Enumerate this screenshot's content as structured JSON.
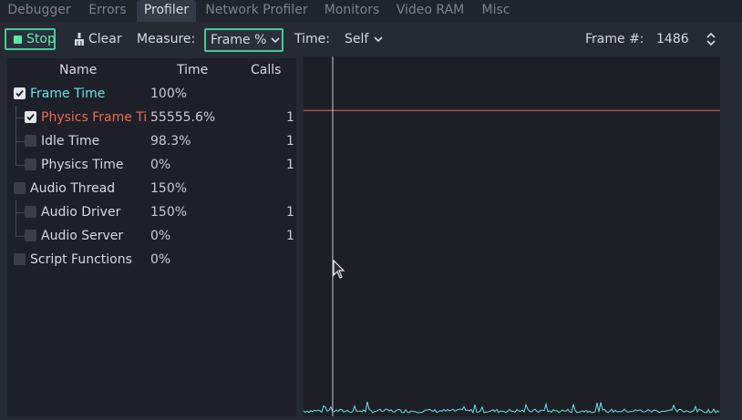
{
  "tabs": [
    {
      "label": "Debugger",
      "active": false
    },
    {
      "label": "Errors",
      "active": false
    },
    {
      "label": "Profiler",
      "active": true
    },
    {
      "label": "Network Profiler",
      "active": false
    },
    {
      "label": "Monitors",
      "active": false
    },
    {
      "label": "Video RAM",
      "active": false
    },
    {
      "label": "Misc",
      "active": false
    }
  ],
  "toolbar": {
    "stop_label": "Stop",
    "clear_label": "Clear",
    "measure_label": "Measure:",
    "measure_value": "Frame %",
    "time_label": "Time:",
    "time_value": "Self",
    "frame_label": "Frame #:",
    "frame_value": "1486"
  },
  "tree": {
    "columns": [
      "Name",
      "Time",
      "Calls"
    ],
    "rows": [
      {
        "name": "Frame Time",
        "time": "100%",
        "calls": "",
        "checked": true,
        "color": "#6fe0e6",
        "indent": 0
      },
      {
        "name": "Physics Frame Time",
        "time": "55555.6%",
        "calls": "1",
        "checked": true,
        "color": "#f06a55",
        "indent": 1
      },
      {
        "name": "Idle Time",
        "time": "98.3%",
        "calls": "1",
        "checked": false,
        "color": "#d6d9de",
        "indent": 1
      },
      {
        "name": "Physics Time",
        "time": "0%",
        "calls": "1",
        "checked": false,
        "color": "#d6d9de",
        "indent": 1
      },
      {
        "name": "Audio Thread",
        "time": "150%",
        "calls": "",
        "checked": false,
        "color": "#d6d9de",
        "indent": 0
      },
      {
        "name": "Audio Driver",
        "time": "150%",
        "calls": "1",
        "checked": false,
        "color": "#d6d9de",
        "indent": 1
      },
      {
        "name": "Audio Server",
        "time": "0%",
        "calls": "1",
        "checked": false,
        "color": "#d6d9de",
        "indent": 1
      },
      {
        "name": "Script Functions",
        "time": "0%",
        "calls": "",
        "checked": false,
        "color": "#d6d9de",
        "indent": 0
      }
    ]
  },
  "graph": {
    "cursor_fraction": 0.07,
    "series": [
      {
        "color": "#f06a55",
        "level": 0.85
      },
      {
        "color": "#6fe0e6",
        "level": 0.01
      }
    ]
  },
  "colors": {
    "accent": "#47c99a",
    "frame_time": "#6fe0e6",
    "physics": "#f06a55"
  }
}
